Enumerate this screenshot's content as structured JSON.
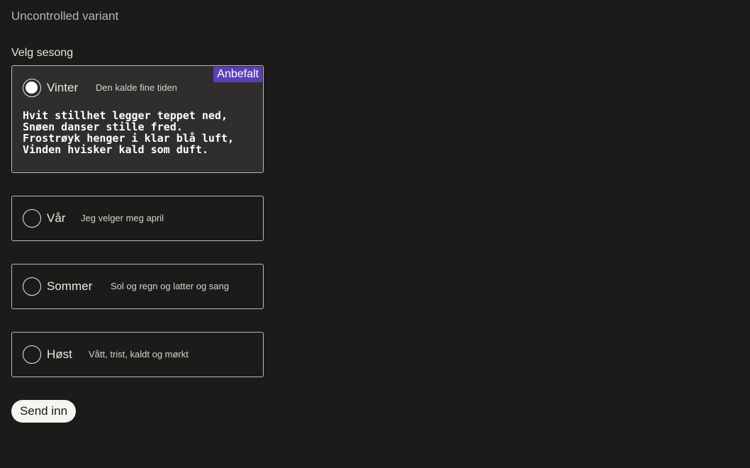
{
  "page": {
    "heading": "Uncontrolled variant",
    "legend": "Velg sesong"
  },
  "options": [
    {
      "label": "Vinter",
      "description": "Den kalde fine tiden",
      "selected": true,
      "badge": "Anbefalt",
      "poem": "Hvit stillhet legger teppet ned,\nSnøen danser stille fred.\nFrostrøyk henger i klar blå luft,\nVinden hvisker kald som duft."
    },
    {
      "label": "Vår",
      "description": "Jeg velger meg april",
      "selected": false
    },
    {
      "label": "Sommer",
      "description": "Sol og regn og latter og sang",
      "selected": false
    },
    {
      "label": "Høst",
      "description": "Vått, trist, kaldt og mørkt",
      "selected": false
    }
  ],
  "submit": {
    "label": "Send inn"
  },
  "colors": {
    "background": "#1c1b19",
    "badge": "#5b3fb5",
    "selected_card": "#2f2e2c"
  }
}
